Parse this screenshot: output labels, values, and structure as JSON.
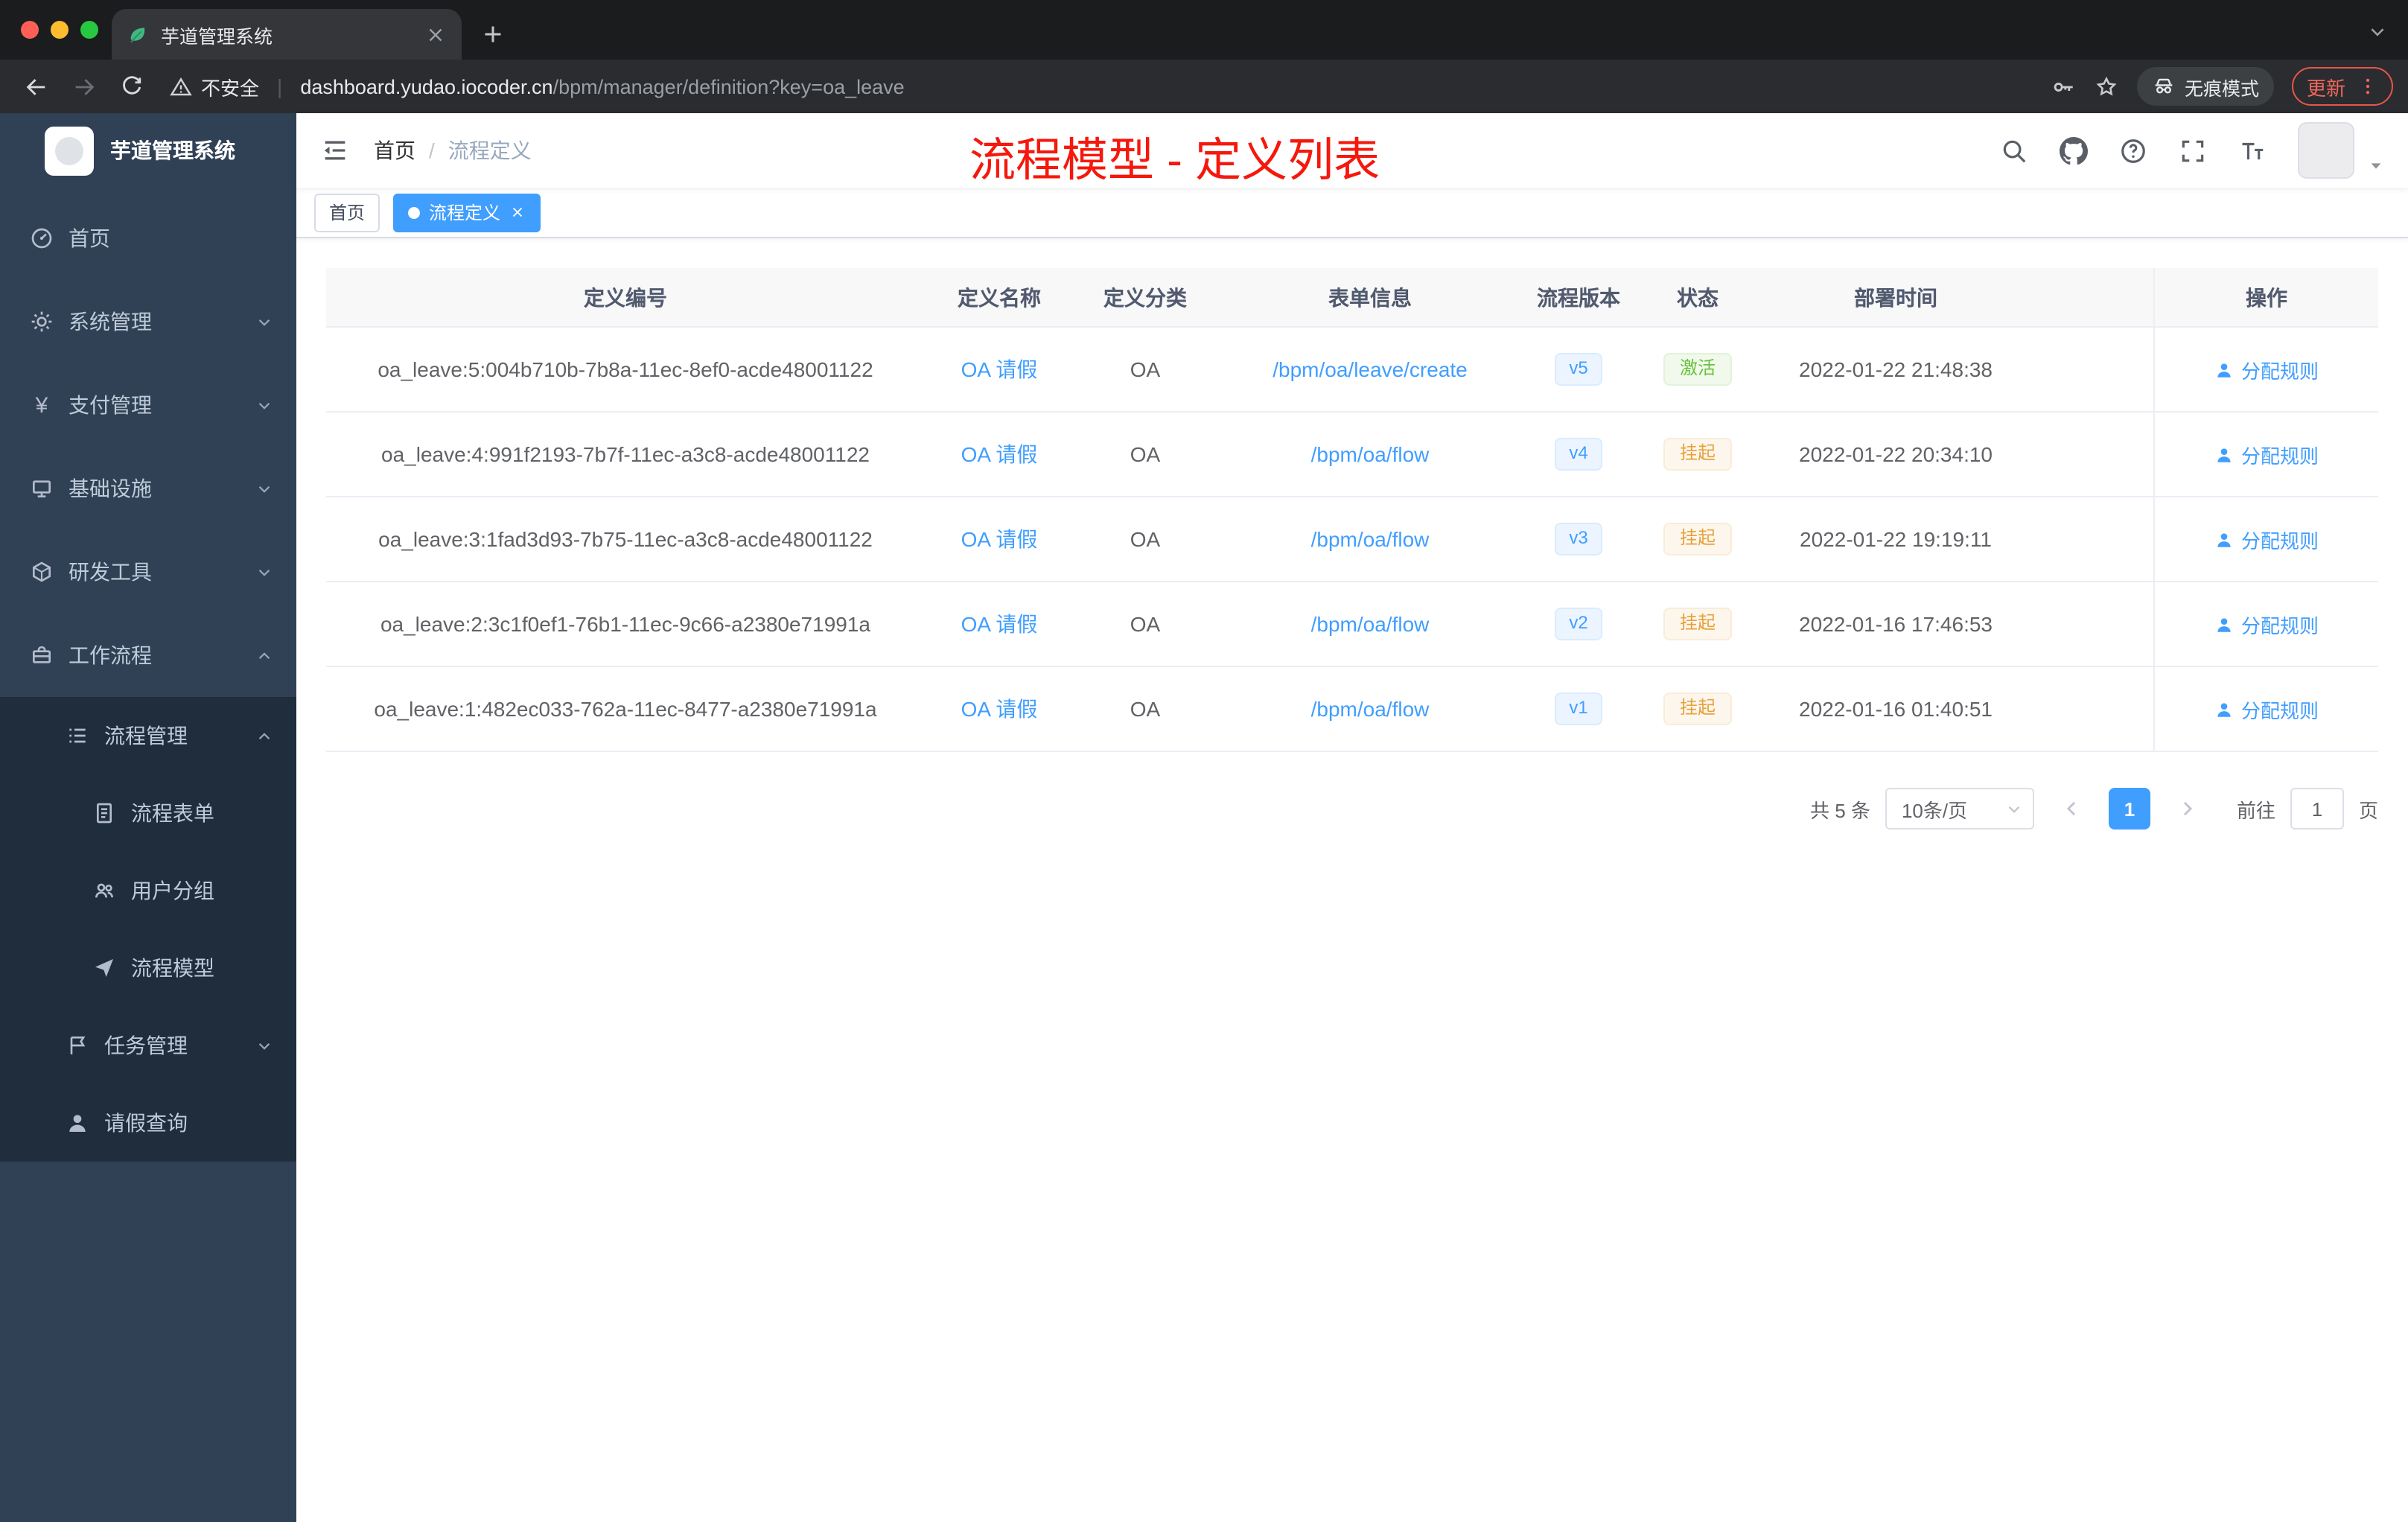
{
  "browser": {
    "tab": {
      "title": "芋道管理系统"
    },
    "toolbar": {
      "security_label": "不安全",
      "url_domain": "dashboard.yudao.iocoder.cn",
      "url_path": "/bpm/manager/definition?key=oa_leave",
      "incognito_label": "无痕模式",
      "update_label": "更新"
    }
  },
  "sidebar": {
    "brand": "芋道管理系统",
    "items": [
      {
        "slug": "home",
        "label": "首页",
        "icon": "dashboard",
        "level": 1,
        "chevron": "none",
        "dark": false
      },
      {
        "slug": "system-mgmt",
        "label": "系统管理",
        "icon": "gear",
        "level": 1,
        "chevron": "down",
        "dark": false
      },
      {
        "slug": "payment-mgmt",
        "label": "支付管理",
        "icon": "yen",
        "level": 1,
        "chevron": "down",
        "dark": false
      },
      {
        "slug": "infrastructure",
        "label": "基础设施",
        "icon": "infra",
        "level": 1,
        "chevron": "down",
        "dark": false
      },
      {
        "slug": "dev-tools",
        "label": "研发工具",
        "icon": "tools",
        "level": 1,
        "chevron": "down",
        "dark": false
      },
      {
        "slug": "workflow",
        "label": "工作流程",
        "icon": "workflow",
        "level": 1,
        "chevron": "up",
        "dark": false
      },
      {
        "slug": "process-mgmt",
        "label": "流程管理",
        "icon": "list",
        "level": 2,
        "chevron": "up",
        "dark": true
      },
      {
        "slug": "process-form",
        "label": "流程表单",
        "icon": "form",
        "level": 3,
        "chevron": "none",
        "dark": true
      },
      {
        "slug": "user-group",
        "label": "用户分组",
        "icon": "users",
        "level": 3,
        "chevron": "none",
        "dark": true
      },
      {
        "slug": "process-model",
        "label": "流程模型",
        "icon": "send",
        "level": 3,
        "chevron": "none",
        "dark": true
      },
      {
        "slug": "task-mgmt",
        "label": "任务管理",
        "icon": "task",
        "level": 2,
        "chevron": "down",
        "dark": true
      },
      {
        "slug": "leave-query",
        "label": "请假查询",
        "icon": "user",
        "level": 2,
        "chevron": "none",
        "dark": true
      }
    ]
  },
  "navbar": {
    "breadcrumb": [
      "首页",
      "流程定义"
    ],
    "annotation": "流程模型 - 定义列表"
  },
  "tags": [
    {
      "slug": "home",
      "label": "首页",
      "active": false
    },
    {
      "slug": "process-definition",
      "label": "流程定义",
      "active": true
    }
  ],
  "table": {
    "columns": [
      "定义编号",
      "定义名称",
      "定义分类",
      "表单信息",
      "流程版本",
      "状态",
      "部署时间",
      "操作"
    ],
    "rows": [
      {
        "id": "oa_leave:5:004b710b-7b8a-11ec-8ef0-acde48001122",
        "name": "OA 请假",
        "category": "OA",
        "form": "/bpm/oa/leave/create",
        "version": "v5",
        "status": "激活",
        "status_type": "success",
        "time": "2022-01-22 21:48:38",
        "action": "分配规则"
      },
      {
        "id": "oa_leave:4:991f2193-7b7f-11ec-a3c8-acde48001122",
        "name": "OA 请假",
        "category": "OA",
        "form": "/bpm/oa/flow",
        "version": "v4",
        "status": "挂起",
        "status_type": "warning",
        "time": "2022-01-22 20:34:10",
        "action": "分配规则"
      },
      {
        "id": "oa_leave:3:1fad3d93-7b75-11ec-a3c8-acde48001122",
        "name": "OA 请假",
        "category": "OA",
        "form": "/bpm/oa/flow",
        "version": "v3",
        "status": "挂起",
        "status_type": "warning",
        "time": "2022-01-22 19:19:11",
        "action": "分配规则"
      },
      {
        "id": "oa_leave:2:3c1f0ef1-76b1-11ec-9c66-a2380e71991a",
        "name": "OA 请假",
        "category": "OA",
        "form": "/bpm/oa/flow",
        "version": "v2",
        "status": "挂起",
        "status_type": "warning",
        "time": "2022-01-16 17:46:53",
        "action": "分配规则"
      },
      {
        "id": "oa_leave:1:482ec033-762a-11ec-8477-a2380e71991a",
        "name": "OA 请假",
        "category": "OA",
        "form": "/bpm/oa/flow",
        "version": "v1",
        "status": "挂起",
        "status_type": "warning",
        "time": "2022-01-16 01:40:51",
        "action": "分配规则"
      }
    ]
  },
  "pagination": {
    "total": "共 5 条",
    "page_size": "10条/页",
    "page": "1",
    "goto": "前往",
    "unit": "页",
    "goto_value": "1"
  },
  "colors": {
    "accent": "#409eff",
    "success": "#67c23a",
    "warning": "#e6a23c",
    "annotation_red": "#f5180c"
  }
}
